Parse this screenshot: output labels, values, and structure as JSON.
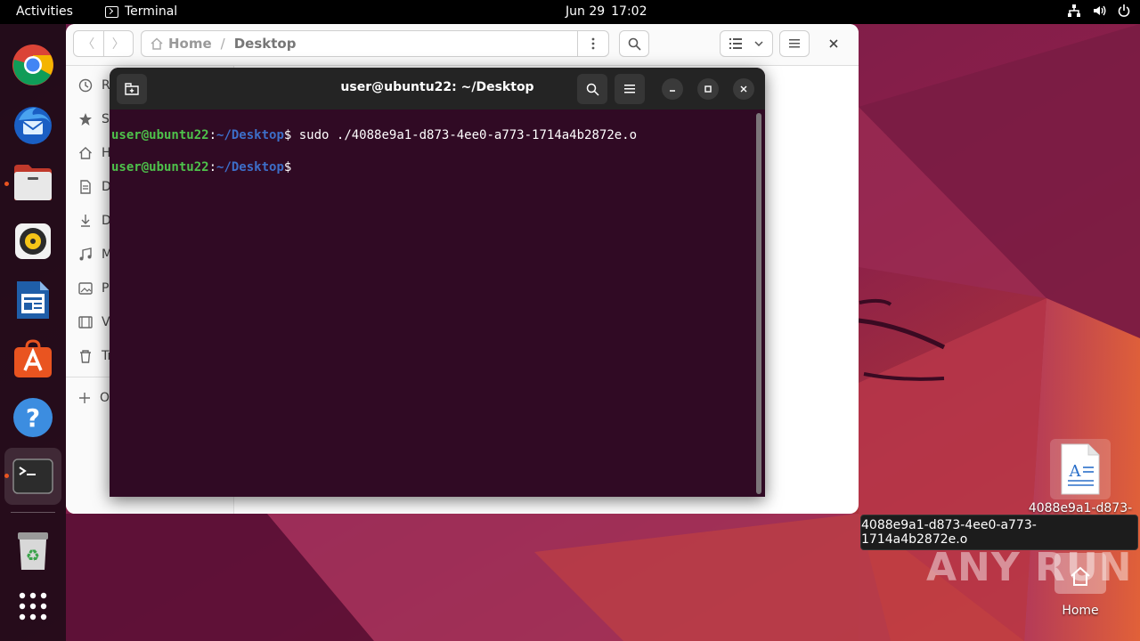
{
  "topbar": {
    "activities": "Activities",
    "app_name": "Terminal",
    "date": "Jun 29",
    "time": "17:02"
  },
  "dock": {
    "items": [
      "chrome",
      "thunderbird",
      "files",
      "rhythmbox",
      "libreoffice-writer",
      "app-center",
      "help",
      "terminal",
      "trash",
      "show-apps"
    ]
  },
  "files": {
    "path_home": "Home",
    "path_sep": "/",
    "path_current": "Desktop",
    "sidebar": [
      {
        "label": "R",
        "icon": "clock-icon"
      },
      {
        "label": "S",
        "icon": "star-icon"
      },
      {
        "label": "H",
        "icon": "home-icon"
      },
      {
        "label": "D",
        "icon": "document-icon"
      },
      {
        "label": "D",
        "icon": "download-icon"
      },
      {
        "label": "M",
        "icon": "music-icon"
      },
      {
        "label": "Pi",
        "icon": "picture-icon"
      },
      {
        "label": "V",
        "icon": "video-icon"
      },
      {
        "label": "Tr",
        "icon": "trash-icon"
      },
      {
        "label": "O",
        "icon": "plus-icon"
      }
    ]
  },
  "terminal": {
    "title": "user@ubuntu22: ~/Desktop",
    "lines": [
      {
        "user": "user@ubuntu22",
        "colon": ":",
        "path": "~/Desktop",
        "dollar": "$",
        "command": " sudo ./4088e9a1-d873-4ee0-a773-1714a4b2872e.o"
      },
      {
        "user": "user@ubuntu22",
        "colon": ":",
        "path": "~/Desktop",
        "dollar": "$",
        "command": ""
      }
    ]
  },
  "desktop": {
    "file_label_line1": "4088e9a1-d873-",
    "file_label_line2": "4ee0-a773-1714",
    "tooltip": "4088e9a1-d873-4ee0-a773-1714a4b2872e.o",
    "home_label": "Home",
    "watermark": "ANY RUN"
  },
  "colors": {
    "accent": "#e95420",
    "terminal_bg": "#300a24",
    "prompt_user": "#4ec24b",
    "prompt_path": "#3d6ec8"
  }
}
